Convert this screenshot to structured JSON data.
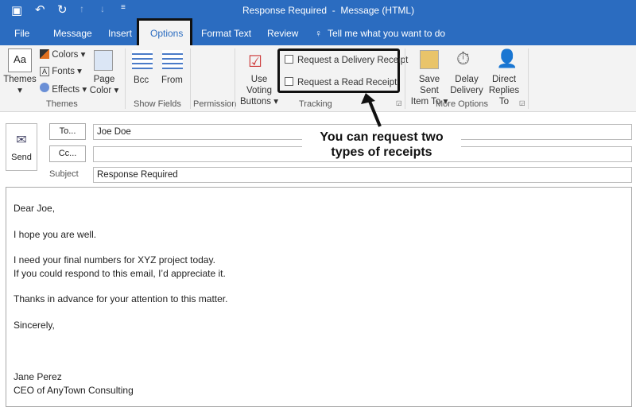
{
  "title": "Response Required  -  Message (HTML)",
  "tabs": [
    "File",
    "Message",
    "Insert",
    "Options",
    "Format Text",
    "Review"
  ],
  "tell_me": "Tell me what you want to do",
  "ribbon": {
    "themes": "Themes",
    "colors": "Colors",
    "fonts": "Fonts",
    "effects": "Effects",
    "page": "Page",
    "color": "Color",
    "bcc": "Bcc",
    "from": "From",
    "use_voting": "Use Voting",
    "buttons": "Buttons",
    "delivery_receipt": "Request a Delivery Receipt",
    "read_receipt": "Request a Read Receipt",
    "save_sent": "Save Sent",
    "item_to": "Item To",
    "delay": "Delay",
    "delivery": "Delivery",
    "direct": "Direct",
    "replies_to": "Replies To",
    "groups": {
      "themes": "Themes",
      "show_fields": "Show Fields",
      "permission": "Permission",
      "tracking": "Tracking",
      "more_options": "More Options"
    }
  },
  "compose": {
    "send": "Send",
    "to_btn": "To...",
    "cc_btn": "Cc...",
    "subject_label": "Subject",
    "to": "Joe Doe",
    "cc": "",
    "subject": "Response Required"
  },
  "annotation": {
    "line1": "You can request two",
    "line2": "types of receipts"
  },
  "body": [
    "Dear Joe,",
    "I hope you are well.",
    "I need your final numbers for XYZ project today.",
    "If you could respond to this email, I’d appreciate it.",
    "Thanks in advance for your attention to this matter.",
    "Sincerely,",
    "Jane Perez",
    "CEO of AnyTown Consulting"
  ]
}
